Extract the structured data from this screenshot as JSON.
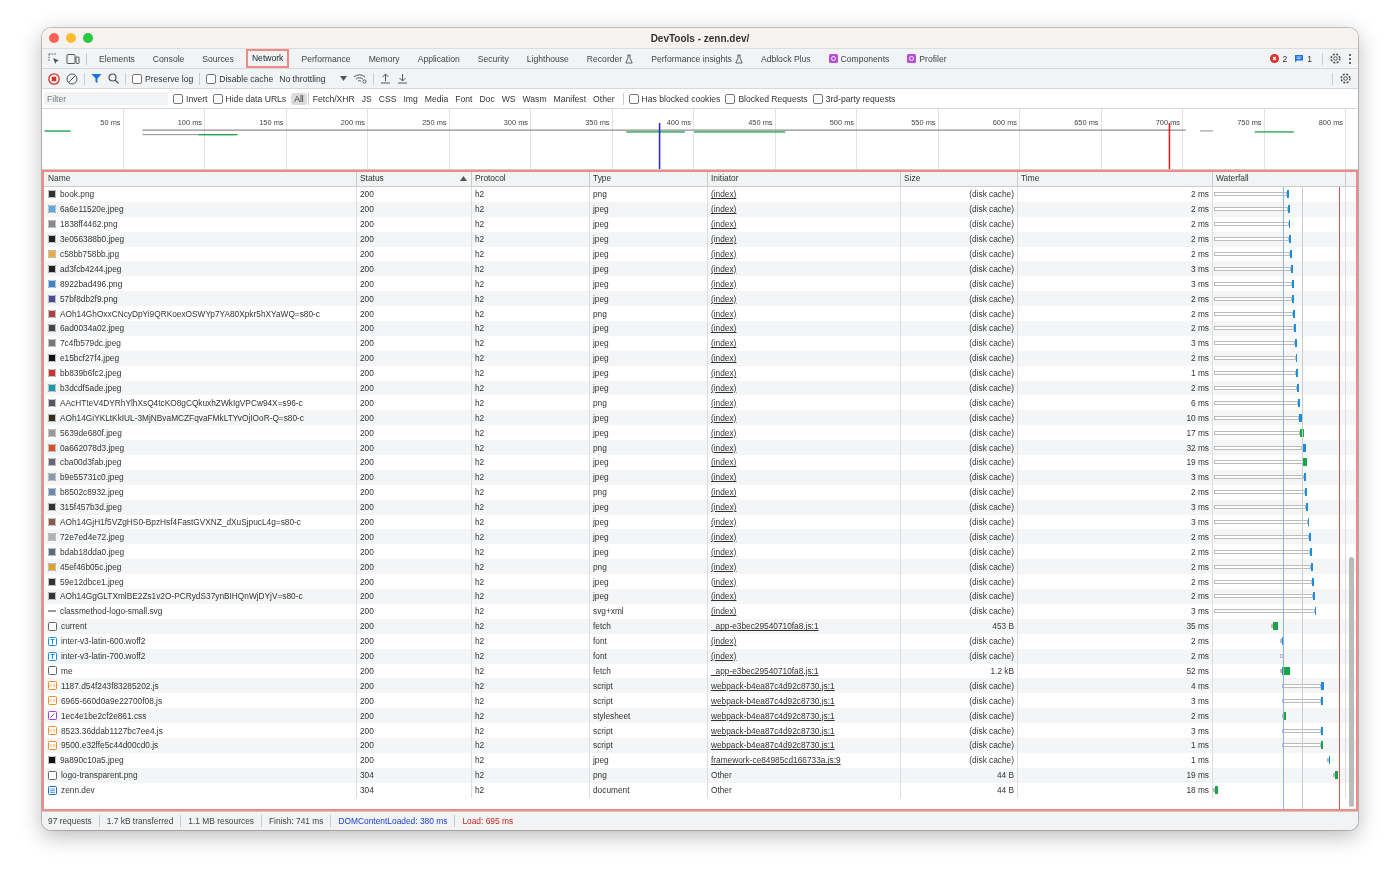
{
  "window": {
    "title": "DevTools - zenn.dev/"
  },
  "tabs": [
    {
      "label": "Elements",
      "selected": false,
      "kind": "plain",
      "highlight": false
    },
    {
      "label": "Console",
      "selected": false,
      "kind": "plain",
      "highlight": false
    },
    {
      "label": "Sources",
      "selected": false,
      "kind": "plain",
      "highlight": false
    },
    {
      "label": "Network",
      "selected": true,
      "kind": "plain",
      "highlight": true
    },
    {
      "label": "Performance",
      "selected": false,
      "kind": "plain",
      "highlight": false
    },
    {
      "label": "Memory",
      "selected": false,
      "kind": "plain",
      "highlight": false
    },
    {
      "label": "Application",
      "selected": false,
      "kind": "plain",
      "highlight": false
    },
    {
      "label": "Security",
      "selected": false,
      "kind": "plain",
      "highlight": false
    },
    {
      "label": "Lighthouse",
      "selected": false,
      "kind": "plain",
      "highlight": false
    },
    {
      "label": "Recorder",
      "selected": false,
      "kind": "experiment",
      "highlight": false
    },
    {
      "label": "Performance insights",
      "selected": false,
      "kind": "experiment",
      "highlight": false
    },
    {
      "label": "Adblock Plus",
      "selected": false,
      "kind": "plain",
      "highlight": false
    },
    {
      "label": "Components",
      "selected": false,
      "kind": "extension",
      "highlight": false
    },
    {
      "label": "Profiler",
      "selected": false,
      "kind": "extension",
      "highlight": false
    }
  ],
  "issue_badges": [
    {
      "count": "2",
      "kind": "error"
    },
    {
      "count": "1",
      "kind": "message"
    }
  ],
  "toolbar": {
    "preserve_log": {
      "label": "Preserve log",
      "checked": false
    },
    "disable_cache": {
      "label": "Disable cache",
      "checked": false
    },
    "throttling": "No throttling"
  },
  "filter_bar": {
    "placeholder": "Filter",
    "checkboxes_left": [
      {
        "label": "Invert",
        "checked": false
      },
      {
        "label": "Hide data URLs",
        "checked": false
      }
    ],
    "types": [
      {
        "label": "All",
        "selected": true
      },
      {
        "label": "Fetch/XHR",
        "selected": false
      },
      {
        "label": "JS",
        "selected": false
      },
      {
        "label": "CSS",
        "selected": false
      },
      {
        "label": "Img",
        "selected": false
      },
      {
        "label": "Media",
        "selected": false
      },
      {
        "label": "Font",
        "selected": false
      },
      {
        "label": "Doc",
        "selected": false
      },
      {
        "label": "WS",
        "selected": false
      },
      {
        "label": "Wasm",
        "selected": false
      },
      {
        "label": "Manifest",
        "selected": false
      },
      {
        "label": "Other",
        "selected": false
      }
    ],
    "checkboxes_right": [
      {
        "label": "Has blocked cookies",
        "checked": false
      },
      {
        "label": "Blocked Requests",
        "checked": false
      },
      {
        "label": "3rd-party requests",
        "checked": false
      }
    ]
  },
  "overview": {
    "ticks": [
      "50 ms",
      "100 ms",
      "150 ms",
      "200 ms",
      "250 ms",
      "300 ms",
      "350 ms",
      "400 ms",
      "450 ms",
      "500 ms",
      "550 ms",
      "600 ms",
      "650 ms",
      "700 ms",
      "750 ms",
      "800 ms"
    ]
  },
  "table": {
    "highlighted": true,
    "columns": [
      {
        "label": "Name",
        "sorted": false
      },
      {
        "label": "Status",
        "sorted": true
      },
      {
        "label": "Protocol",
        "sorted": false
      },
      {
        "label": "Type",
        "sorted": false
      },
      {
        "label": "Initiator",
        "sorted": false
      },
      {
        "label": "Size",
        "sorted": false
      },
      {
        "label": "Time",
        "sorted": false
      },
      {
        "label": "Waterfall",
        "sorted": false
      }
    ],
    "rows": [
      {
        "name": "book.png",
        "kind": "image",
        "status": "200",
        "protocol": "h2",
        "type": "png",
        "initiator": "(index)",
        "initiator_link": true,
        "size": "(disk cache)",
        "time": "2 ms"
      },
      {
        "name": "6a6e11520e.jpeg",
        "kind": "image",
        "status": "200",
        "protocol": "h2",
        "type": "jpeg",
        "initiator": "(index)",
        "initiator_link": true,
        "size": "(disk cache)",
        "time": "2 ms"
      },
      {
        "name": "1838ff4462.png",
        "kind": "image",
        "status": "200",
        "protocol": "h2",
        "type": "jpeg",
        "initiator": "(index)",
        "initiator_link": true,
        "size": "(disk cache)",
        "time": "2 ms"
      },
      {
        "name": "3e056388b0.jpeg",
        "kind": "image",
        "status": "200",
        "protocol": "h2",
        "type": "jpeg",
        "initiator": "(index)",
        "initiator_link": true,
        "size": "(disk cache)",
        "time": "2 ms"
      },
      {
        "name": "c58bb758bb.jpg",
        "kind": "image",
        "status": "200",
        "protocol": "h2",
        "type": "jpeg",
        "initiator": "(index)",
        "initiator_link": true,
        "size": "(disk cache)",
        "time": "2 ms"
      },
      {
        "name": "ad3fcb4244.jpeg",
        "kind": "image",
        "status": "200",
        "protocol": "h2",
        "type": "jpeg",
        "initiator": "(index)",
        "initiator_link": true,
        "size": "(disk cache)",
        "time": "3 ms"
      },
      {
        "name": "8922bad496.png",
        "kind": "image",
        "status": "200",
        "protocol": "h2",
        "type": "jpeg",
        "initiator": "(index)",
        "initiator_link": true,
        "size": "(disk cache)",
        "time": "3 ms"
      },
      {
        "name": "57bf8db2f9.png",
        "kind": "image",
        "status": "200",
        "protocol": "h2",
        "type": "jpeg",
        "initiator": "(index)",
        "initiator_link": true,
        "size": "(disk cache)",
        "time": "2 ms"
      },
      {
        "name": "AOh14GhOxxCNcyDpYi9QRKoexOSWYp7YA80Xpkr5hXYaWQ=s80-c",
        "kind": "image",
        "status": "200",
        "protocol": "h2",
        "type": "png",
        "initiator": "(index)",
        "initiator_link": true,
        "size": "(disk cache)",
        "time": "2 ms"
      },
      {
        "name": "6ad0034a02.jpeg",
        "kind": "image",
        "status": "200",
        "protocol": "h2",
        "type": "jpeg",
        "initiator": "(index)",
        "initiator_link": true,
        "size": "(disk cache)",
        "time": "2 ms"
      },
      {
        "name": "7c4fb579dc.jpeg",
        "kind": "image",
        "status": "200",
        "protocol": "h2",
        "type": "jpeg",
        "initiator": "(index)",
        "initiator_link": true,
        "size": "(disk cache)",
        "time": "3 ms"
      },
      {
        "name": "e15bcf27f4.jpeg",
        "kind": "image",
        "status": "200",
        "protocol": "h2",
        "type": "jpeg",
        "initiator": "(index)",
        "initiator_link": true,
        "size": "(disk cache)",
        "time": "2 ms"
      },
      {
        "name": "bb839b6fc2.jpeg",
        "kind": "image",
        "status": "200",
        "protocol": "h2",
        "type": "jpeg",
        "initiator": "(index)",
        "initiator_link": true,
        "size": "(disk cache)",
        "time": "1 ms"
      },
      {
        "name": "b3dcdf5ade.jpeg",
        "kind": "image",
        "status": "200",
        "protocol": "h2",
        "type": "jpeg",
        "initiator": "(index)",
        "initiator_link": true,
        "size": "(disk cache)",
        "time": "2 ms"
      },
      {
        "name": "AAcHTteV4DYRhYlhXsQ4tcKO8gCQkuxhZWkIgVPCw94X=s96-c",
        "kind": "image",
        "status": "200",
        "protocol": "h2",
        "type": "png",
        "initiator": "(index)",
        "initiator_link": true,
        "size": "(disk cache)",
        "time": "6 ms"
      },
      {
        "name": "AOh14GiYKLtKkIUL-3MjNBvaMCZFqvaFMkLTYvOjIOoR-Q=s80-c",
        "kind": "image",
        "status": "200",
        "protocol": "h2",
        "type": "jpeg",
        "initiator": "(index)",
        "initiator_link": true,
        "size": "(disk cache)",
        "time": "10 ms"
      },
      {
        "name": "5639de680f.jpeg",
        "kind": "image",
        "status": "200",
        "protocol": "h2",
        "type": "jpeg",
        "initiator": "(index)",
        "initiator_link": true,
        "size": "(disk cache)",
        "time": "17 ms"
      },
      {
        "name": "0a662078d3.jpeg",
        "kind": "image",
        "status": "200",
        "protocol": "h2",
        "type": "png",
        "initiator": "(index)",
        "initiator_link": true,
        "size": "(disk cache)",
        "time": "32 ms"
      },
      {
        "name": "cba00d3fab.jpeg",
        "kind": "image",
        "status": "200",
        "protocol": "h2",
        "type": "jpeg",
        "initiator": "(index)",
        "initiator_link": true,
        "size": "(disk cache)",
        "time": "19 ms"
      },
      {
        "name": "b9e55731c0.jpeg",
        "kind": "image",
        "status": "200",
        "protocol": "h2",
        "type": "jpeg",
        "initiator": "(index)",
        "initiator_link": true,
        "size": "(disk cache)",
        "time": "3 ms"
      },
      {
        "name": "b8502c8932.jpeg",
        "kind": "image",
        "status": "200",
        "protocol": "h2",
        "type": "png",
        "initiator": "(index)",
        "initiator_link": true,
        "size": "(disk cache)",
        "time": "2 ms"
      },
      {
        "name": "315f457b3d.jpeg",
        "kind": "image",
        "status": "200",
        "protocol": "h2",
        "type": "jpeg",
        "initiator": "(index)",
        "initiator_link": true,
        "size": "(disk cache)",
        "time": "3 ms"
      },
      {
        "name": "AOh14GjH1f5VZgHS0-BpzHsf4FastGVXNZ_dXuSjpucL4g=s80-c",
        "kind": "image",
        "status": "200",
        "protocol": "h2",
        "type": "jpeg",
        "initiator": "(index)",
        "initiator_link": true,
        "size": "(disk cache)",
        "time": "3 ms"
      },
      {
        "name": "72e7ed4e72.jpeg",
        "kind": "image",
        "status": "200",
        "protocol": "h2",
        "type": "jpeg",
        "initiator": "(index)",
        "initiator_link": true,
        "size": "(disk cache)",
        "time": "2 ms"
      },
      {
        "name": "bdab18dda0.jpeg",
        "kind": "image",
        "status": "200",
        "protocol": "h2",
        "type": "jpeg",
        "initiator": "(index)",
        "initiator_link": true,
        "size": "(disk cache)",
        "time": "2 ms"
      },
      {
        "name": "45ef46b05c.jpeg",
        "kind": "image",
        "status": "200",
        "protocol": "h2",
        "type": "png",
        "initiator": "(index)",
        "initiator_link": true,
        "size": "(disk cache)",
        "time": "2 ms"
      },
      {
        "name": "59e12dbce1.jpeg",
        "kind": "image",
        "status": "200",
        "protocol": "h2",
        "type": "jpeg",
        "initiator": "(index)",
        "initiator_link": true,
        "size": "(disk cache)",
        "time": "2 ms"
      },
      {
        "name": "AOh14GgGLTXmlBE2Zs1v2O-PCRydS37ynBIHQnWjDYjV=s80-c",
        "kind": "image",
        "status": "200",
        "protocol": "h2",
        "type": "jpeg",
        "initiator": "(index)",
        "initiator_link": true,
        "size": "(disk cache)",
        "time": "2 ms"
      },
      {
        "name": "classmethod-logo-small.svg",
        "kind": "svg",
        "status": "200",
        "protocol": "h2",
        "type": "svg+xml",
        "initiator": "(index)",
        "initiator_link": true,
        "size": "(disk cache)",
        "time": "3 ms"
      },
      {
        "name": "current",
        "kind": "fetch",
        "status": "200",
        "protocol": "h2",
        "type": "fetch",
        "initiator": "_app-e3bec29540710fa8.js:1",
        "initiator_link": true,
        "size": "453 B",
        "time": "35 ms"
      },
      {
        "name": "inter-v3-latin-600.woff2",
        "kind": "font",
        "status": "200",
        "protocol": "h2",
        "type": "font",
        "initiator": "(index)",
        "initiator_link": true,
        "size": "(disk cache)",
        "time": "2 ms"
      },
      {
        "name": "inter-v3-latin-700.woff2",
        "kind": "font",
        "status": "200",
        "protocol": "h2",
        "type": "font",
        "initiator": "(index)",
        "initiator_link": true,
        "size": "(disk cache)",
        "time": "2 ms"
      },
      {
        "name": "me",
        "kind": "fetch",
        "status": "200",
        "protocol": "h2",
        "type": "fetch",
        "initiator": "_app-e3bec29540710fa8.js:1",
        "initiator_link": true,
        "size": "1.2 kB",
        "time": "52 ms"
      },
      {
        "name": "1187.d54f243f83285202.js",
        "kind": "script",
        "status": "200",
        "protocol": "h2",
        "type": "script",
        "initiator": "webpack-b4ea87c4d92c8730.js:1",
        "initiator_link": true,
        "size": "(disk cache)",
        "time": "4 ms"
      },
      {
        "name": "6965-660d0a9e22700f08.js",
        "kind": "script",
        "status": "200",
        "protocol": "h2",
        "type": "script",
        "initiator": "webpack-b4ea87c4d92c8730.js:1",
        "initiator_link": true,
        "size": "(disk cache)",
        "time": "3 ms"
      },
      {
        "name": "1ec4e1be2cf2e861.css",
        "kind": "style",
        "status": "200",
        "protocol": "h2",
        "type": "stylesheet",
        "initiator": "webpack-b4ea87c4d92c8730.js:1",
        "initiator_link": true,
        "size": "(disk cache)",
        "time": "2 ms"
      },
      {
        "name": "8523.36ddab1127bc7ee4.js",
        "kind": "script",
        "status": "200",
        "protocol": "h2",
        "type": "script",
        "initiator": "webpack-b4ea87c4d92c8730.js:1",
        "initiator_link": true,
        "size": "(disk cache)",
        "time": "3 ms"
      },
      {
        "name": "9500.e32ffe5c44d00cd0.js",
        "kind": "script",
        "status": "200",
        "protocol": "h2",
        "type": "script",
        "initiator": "webpack-b4ea87c4d92c8730.js:1",
        "initiator_link": true,
        "size": "(disk cache)",
        "time": "1 ms"
      },
      {
        "name": "9a890c10a5.jpeg",
        "kind": "image",
        "status": "200",
        "protocol": "h2",
        "type": "jpeg",
        "initiator": "framework-ce84985cd166733a.js:9",
        "initiator_link": true,
        "size": "(disk cache)",
        "time": "1 ms"
      },
      {
        "name": "logo-transparent.png",
        "kind": "fetch",
        "status": "304",
        "protocol": "h2",
        "type": "png",
        "initiator": "Other",
        "initiator_link": false,
        "size": "44 B",
        "time": "19 ms"
      },
      {
        "name": "zenn.dev",
        "kind": "document",
        "status": "304",
        "protocol": "h2",
        "type": "document",
        "initiator": "Other",
        "initiator_link": false,
        "size": "44 B",
        "time": "18 ms"
      }
    ]
  },
  "status_bar": [
    {
      "text": "97 requests",
      "kind": "plain"
    },
    {
      "text": "1.7 kB transferred",
      "kind": "plain"
    },
    {
      "text": "1.1 MB resources",
      "kind": "plain"
    },
    {
      "text": "Finish: 741 ms",
      "kind": "plain"
    },
    {
      "text": "DOMContentLoaded: 380 ms",
      "kind": "dom"
    },
    {
      "text": "Load: 695 ms",
      "kind": "load"
    }
  ]
}
